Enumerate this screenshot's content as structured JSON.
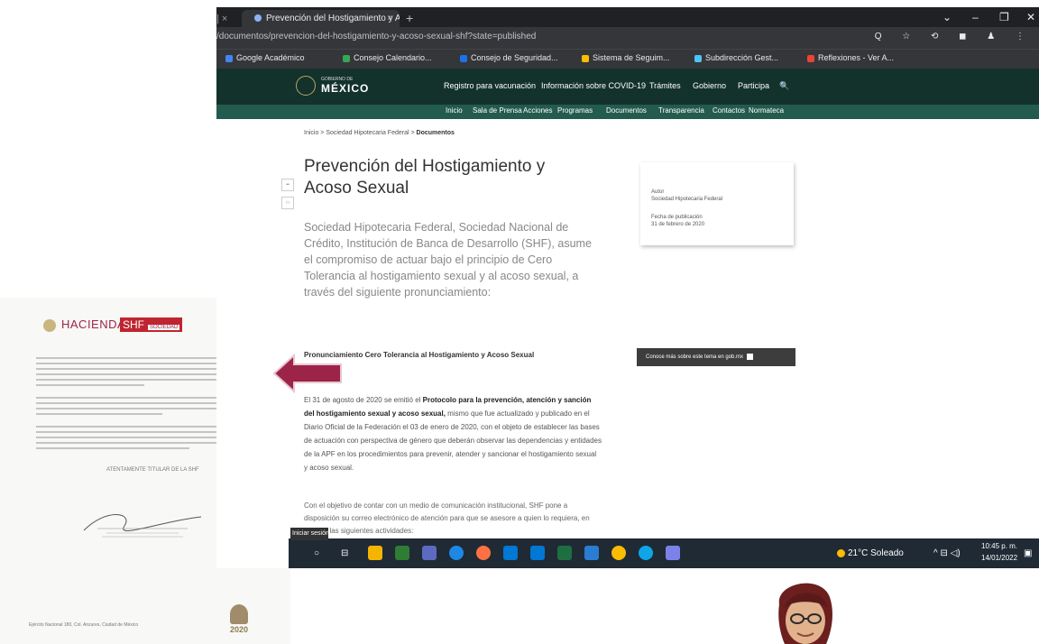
{
  "browser": {
    "prev_tab": "| ×",
    "tab_title": "Prevención del Hostigamiento y A...",
    "tab_close": "×",
    "new_tab": "+",
    "window_controls": [
      "⌄",
      "–",
      "❐",
      "✕"
    ],
    "url": "/documentos/prevencion-del-hostigamiento-y-acoso-sexual-shf?state=published",
    "addr_icons": "Q ☆ ⟲ ◼ ♟ ⋮",
    "bookmarks": [
      {
        "label": "Google Académico",
        "color": "#4285f4"
      },
      {
        "label": "Consejo Calendario...",
        "color": "#34a853"
      },
      {
        "label": "Consejo de Seguridad...",
        "color": "#1a73e8"
      },
      {
        "label": "Sistema de Seguim...",
        "color": "#fbbc04"
      },
      {
        "label": "Subdirección Gest...",
        "color": "#4fc3f7"
      },
      {
        "label": "Reflexiones - Ver A...",
        "color": "#ea4335"
      }
    ]
  },
  "gob": {
    "logo_small": "GOBIERNO DE",
    "logo_big": "MÉXICO",
    "nav": [
      "Registro para vacunación",
      "Información sobre COVID-19",
      "Trámites",
      "Gobierno",
      "Participa",
      "🔍"
    ],
    "subnav": [
      "Inicio",
      "Sala de Prensa",
      "Acciones",
      "Programas",
      "Documentos",
      "Transparencia",
      "Contactos",
      "Normateca"
    ]
  },
  "page": {
    "breadcrumb_prefix": "Inicio > Sociedad Hipotecaria Federal >",
    "breadcrumb_current": "Documentos",
    "title": "Prevención del Hostigamiento y Acoso Sexual",
    "share_labels": [
      "••",
      "□"
    ],
    "intro": "Sociedad Hipotecaria Federal, Sociedad Nacional de Crédito, Institución de Banca de Desarrollo (SHF), asume el compromiso de actuar bajo el principio de Cero Tolerancia al hostigamiento sexual y al acoso sexual, a través del siguiente pronunciamiento:",
    "pron_heading": "Pronunciamiento Cero Tolerancia al Hostigamiento y Acoso Sexual",
    "body_start": "El 31 de agosto de 2020 se emitió el ",
    "body_bold": "Protocolo para la prevención, atención y sanción del hostigamiento sexual y acoso sexual,",
    "body_rest": " mismo que fue actualizado y publicado en el Diario Oficial de la Federación el 03 de enero de 2020, con el objeto de establecer las bases de actuación con perspectiva de género que deberán observar las dependencias y entidades de la APF en los procedimientos para prevenir, atender y sancionar el hostigamiento sexual y acoso sexual.",
    "body2": "Con el objetivo de contar con un medio de comunicación institucional, SHF pone a disposición su correo electrónico de atención para que se asesore a quien lo requiera, en realizar las siguientes actividades:",
    "side_label1": "Autor",
    "side_value1": "Sociedad Hipotecaria Federal",
    "side_label2": "Fecha de publicación",
    "side_value2": "31 de febrero de 2020",
    "dark_box": "Conoce más sobre este tema en gob.mx",
    "tooltip": "Iniciar sesión"
  },
  "taskbar": {
    "start": "○",
    "search": "⊟",
    "apps": [
      {
        "name": "file-explorer",
        "color": "#f4b400"
      },
      {
        "name": "photos",
        "color": "#2e7d32"
      },
      {
        "name": "teams",
        "color": "#5c6bc0"
      },
      {
        "name": "ie",
        "color": "#1e88e5"
      },
      {
        "name": "firefox",
        "color": "#ff7043"
      },
      {
        "name": "store",
        "color": "#0078d4"
      },
      {
        "name": "outlook",
        "color": "#0078d4"
      },
      {
        "name": "excel",
        "color": "#1d6f42"
      },
      {
        "name": "word",
        "color": "#2b7cd3"
      },
      {
        "name": "chrome",
        "color": "#fbbc04"
      },
      {
        "name": "edge",
        "color": "#0ea5e9"
      },
      {
        "name": "teams-2",
        "color": "#7b83eb"
      }
    ],
    "weather": "21°C Soleado",
    "tray": "^ ⊟ ◁)",
    "time": "10:45 p. m.",
    "date": "14/01/2022"
  },
  "document": {
    "logo_left": "HACIENDA",
    "logo_right": "SHF",
    "logo_right_small": "SOCIEDAD",
    "sig_caption": "ATENTAMENTE TITULAR DE LA SHF",
    "footer": "Ejército Nacional 180, Col. Anzures, Ciudad de México",
    "year": "2020"
  },
  "colors": {
    "arrow": "#9d2449",
    "gob_dark": "#13322b",
    "gob_sub": "#235b4e"
  }
}
